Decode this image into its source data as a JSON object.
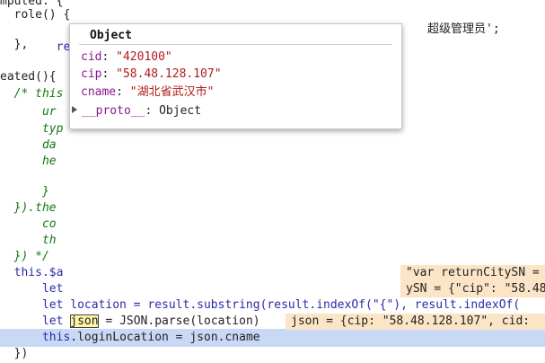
{
  "code": {
    "line1": "mputed: {",
    "line2_a": "  role() {",
    "line3_a": "    ret",
    "line3_b": "超级管理员';",
    "line4": "  },",
    "line5": "eated(){",
    "line6": "  /* this",
    "line7": "      ur",
    "line8": "      typ",
    "line9": "      da",
    "line10": "      he",
    "line12": "      }",
    "line13": "  }).the",
    "line14": "      co",
    "line15": "      th",
    "line16": "  }) */",
    "line17": "  this.$a",
    "line18": "      let",
    "line19_a": "      let location = result.substring(result.indexOf(\"{\"), result.indexOf(",
    "line19_hint": "ySN = {\"cip\": \"58.48",
    "line20_let": "let",
    "line20_json": "json",
    "line20_rest": " = JSON.parse(location)",
    "line21_this": "this",
    "line21_rest": ".loginLocation = json.cname",
    "line22": "  })"
  },
  "inline_values": {
    "return_city": "\"var returnCitySN =",
    "json_value": "json = {cip: \"58.48.128.107\", cid:"
  },
  "tooltip": {
    "title": "Object",
    "cid_key": "cid",
    "cid_val": "\"420100\"",
    "cip_key": "cip",
    "cip_val": "\"58.48.128.107\"",
    "cname_key": "cname",
    "cname_val": "\"湖北省武汉市\"",
    "proto_key": "__proto__",
    "proto_val": "Object"
  },
  "colors": {
    "highlight": "#c9d8f5",
    "inline_bg": "#fbe5c6"
  }
}
